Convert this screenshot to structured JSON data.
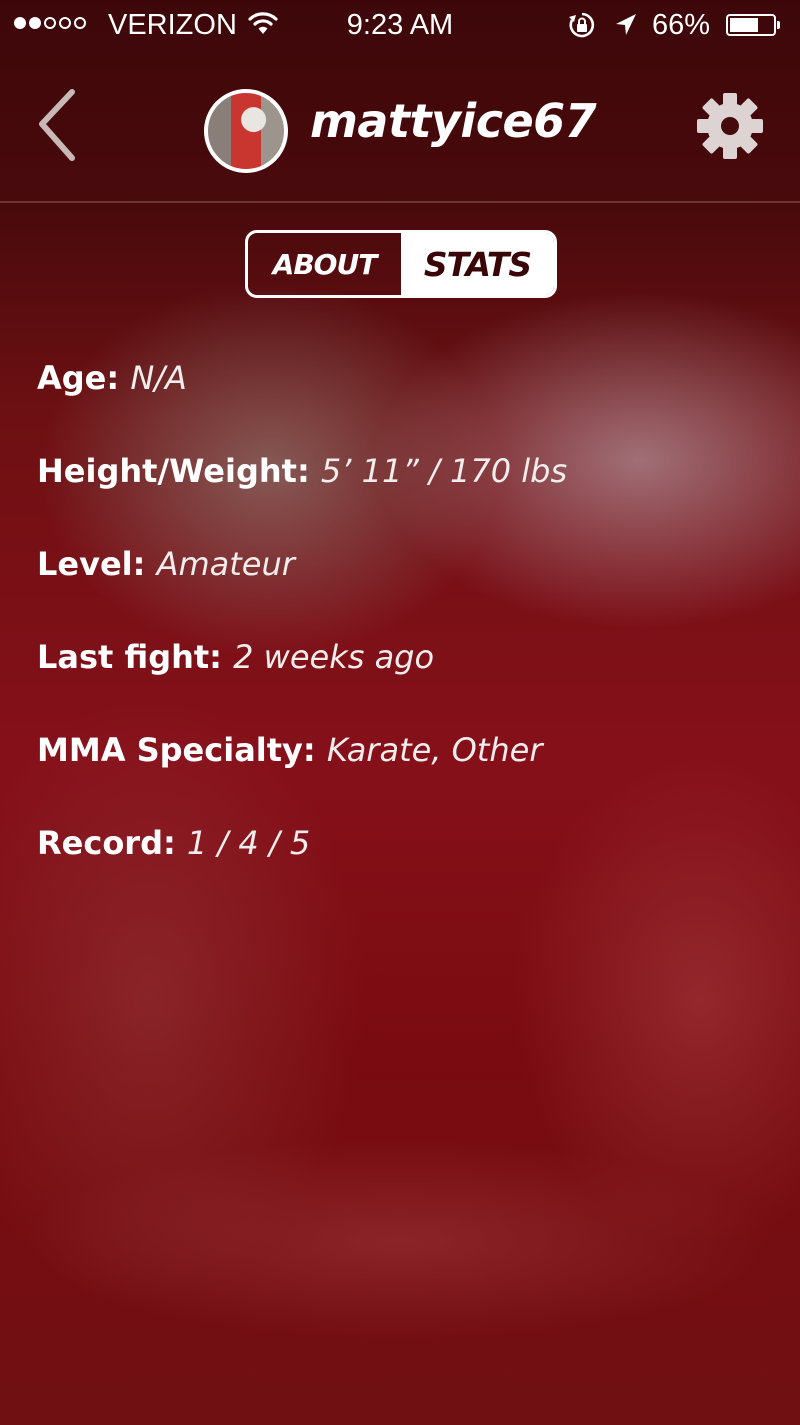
{
  "status_bar": {
    "signal": {
      "filled": 2,
      "total": 5
    },
    "carrier": "VERIZON",
    "time": "9:23 AM",
    "battery_percent_text": "66%",
    "battery_level": 0.66
  },
  "nav": {
    "username": "mattyice67",
    "icons": [
      "chevron-left-icon",
      "avatar",
      "gear-icon"
    ]
  },
  "tabs": {
    "items": [
      {
        "label": "ABOUT",
        "selected": false
      },
      {
        "label": "STATS",
        "selected": true
      }
    ]
  },
  "stats": [
    {
      "label": "Age",
      "value": "N/A"
    },
    {
      "label": "Height/Weight",
      "value": "5’ 11” / 170 lbs"
    },
    {
      "label": "Level",
      "value": "Amateur"
    },
    {
      "label": "Last fight",
      "value": "2 weeks ago"
    },
    {
      "label": "MMA Specialty",
      "value": "Karate, Other"
    },
    {
      "label": "Record",
      "value": "1 / 4 / 5"
    }
  ],
  "colors": {
    "background": "#6e0b0d",
    "header": "#3d0709",
    "text": "#ffffff",
    "tab_selected_text": "#3a0507"
  }
}
